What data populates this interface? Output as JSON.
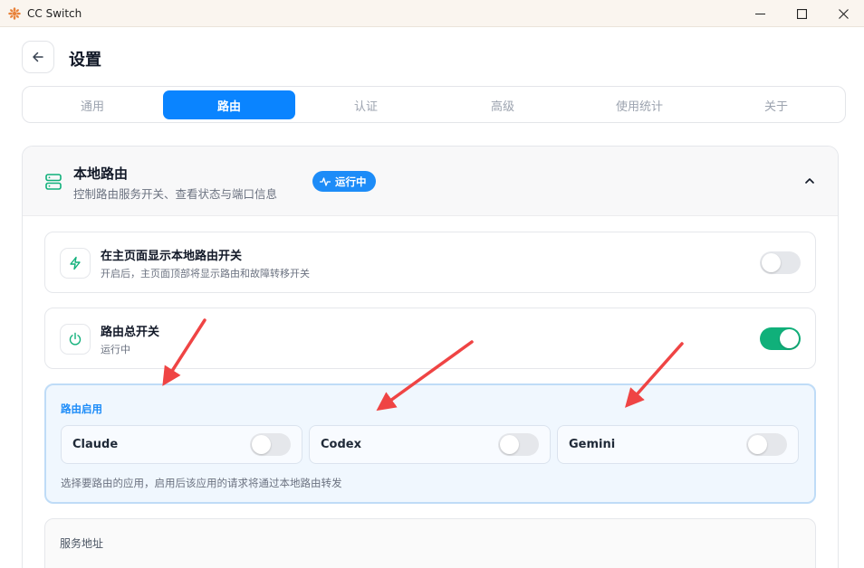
{
  "window": {
    "title": "CC Switch"
  },
  "header": {
    "title": "设置"
  },
  "tabs": [
    {
      "label": "通用",
      "active": false
    },
    {
      "label": "路由",
      "active": true
    },
    {
      "label": "认证",
      "active": false
    },
    {
      "label": "高级",
      "active": false
    },
    {
      "label": "使用统计",
      "active": false
    },
    {
      "label": "关于",
      "active": false
    }
  ],
  "section": {
    "title": "本地路由",
    "subtitle": "控制路由服务开关、查看状态与端口信息",
    "badge": "运行中",
    "icon": "server-icon"
  },
  "rows": [
    {
      "title": "在主页面显示本地路由开关",
      "subtitle": "开启后，主页面顶部将显示路由和故障转移开关",
      "icon": "lightning-icon",
      "enabled": false
    },
    {
      "title": "路由总开关",
      "subtitle": "运行中",
      "icon": "power-icon",
      "enabled": true
    }
  ],
  "routing": {
    "label": "路由启用",
    "apps": [
      {
        "name": "Claude",
        "enabled": false
      },
      {
        "name": "Codex",
        "enabled": false
      },
      {
        "name": "Gemini",
        "enabled": false
      }
    ],
    "hint": "选择要路由的应用，启用后该应用的请求将通过本地路由转发"
  },
  "service": {
    "label": "服务地址"
  },
  "colors": {
    "accent": "#0a84ff",
    "badge": "#1d8cf8",
    "toggle_on": "#10b07a",
    "icon_green": "#10b07a",
    "arrow": "#ef4444"
  }
}
